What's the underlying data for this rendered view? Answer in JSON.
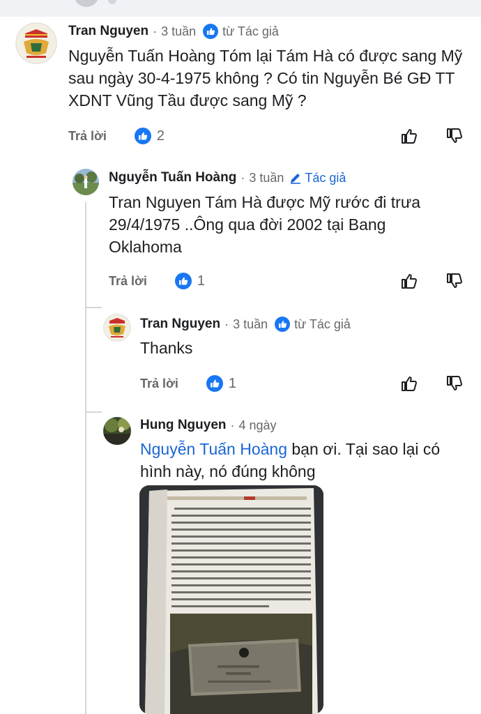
{
  "comments": [
    {
      "author": "Tran Nguyen",
      "time": "3 tuần",
      "badge": "từ Tác giả",
      "text": "Nguyễn Tuấn Hoàng Tóm lại Tám Hà có được sang Mỹ sau ngày 30-4-1975 không ? Có tin Nguyễn Bé GĐ TT XDNT Vũng Tầu được sang Mỹ ?",
      "reply_label": "Trả lời",
      "like_count": "2"
    },
    {
      "author": "Nguyễn Tuấn Hoàng",
      "time": "3 tuần",
      "badge": "Tác giả",
      "text": "Tran Nguyen Tám Hà được Mỹ rước đi trưa 29/4/1975 ..Ông qua đời 2002 tại Bang Oklahoma",
      "reply_label": "Trả lời",
      "like_count": "1"
    },
    {
      "author": "Tran Nguyen",
      "time": "3 tuần",
      "badge": "từ Tác giả",
      "text": "Thanks",
      "reply_label": "Trả lời",
      "like_count": "1"
    },
    {
      "author": "Hung Nguyen",
      "time": "4 ngày",
      "mention": "Nguyễn Tuấn Hoàng",
      "text": " bạn ơi. Tại sao lại có hình này, nó đúng không"
    }
  ],
  "colors": {
    "link": "#1a66d2",
    "secondary_text": "#65676b",
    "like_blue": "#1877f2"
  },
  "icons": [
    "thumbs-up-icon",
    "thumbs-down-icon",
    "like-reaction-icon",
    "author-badge-icon",
    "pen-icon"
  ]
}
